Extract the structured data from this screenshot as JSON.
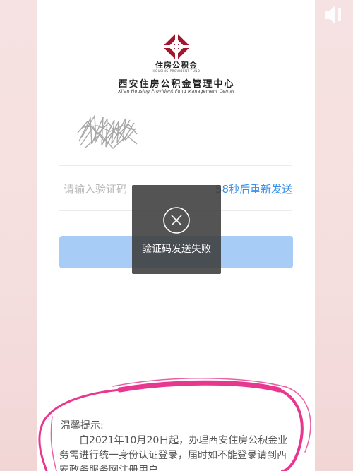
{
  "brand": {
    "logo_cn": "住房公积金",
    "logo_en": "HOUSING PROVIDENT FUND",
    "org_name": "西安住房公积金管理中心",
    "org_en": "Xi'an Housing Provident Fund Management Center",
    "logo_color": "#a3172e"
  },
  "form": {
    "code_placeholder": "请输入验证码",
    "code_value": "",
    "resend_label": "58秒后重新发送",
    "login_button_label": ""
  },
  "toast": {
    "icon": "close-circle-icon",
    "message": "验证码发送失败"
  },
  "notice": {
    "title": "温馨提示:",
    "body": "自2021年10月20日起，办理西安住房公积金业务需进行统一身份认证登录，届时如不能登录请到西安政务服务网注册用户"
  },
  "colors": {
    "accent": "#3a8ee6",
    "button_disabled": "#a7cdf6",
    "highlight_marker": "#e8378f"
  },
  "overlay_icons": {
    "volume": "volume-muted-icon"
  }
}
